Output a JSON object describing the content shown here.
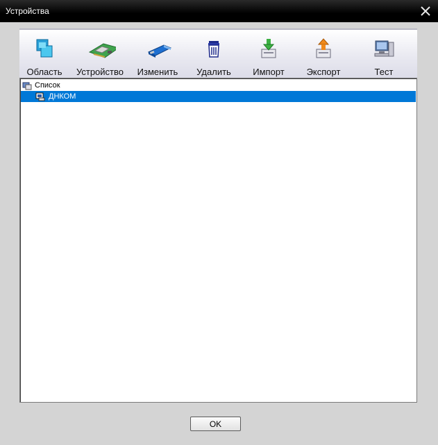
{
  "window": {
    "title": "Устройства"
  },
  "toolbar": {
    "items": [
      {
        "label": "Область",
        "icon": "area-icon"
      },
      {
        "label": "Устройство",
        "icon": "device-board-icon"
      },
      {
        "label": "Изменить",
        "icon": "edit-stick-icon"
      },
      {
        "label": "Удалить",
        "icon": "trash-icon"
      },
      {
        "label": "Импорт",
        "icon": "import-icon"
      },
      {
        "label": "Экспорт",
        "icon": "export-icon"
      },
      {
        "label": "Тест",
        "icon": "computer-test-icon"
      }
    ]
  },
  "tree": {
    "root": {
      "label": "Список",
      "icon": "list-root-icon"
    },
    "children": [
      {
        "label": "ДНКОМ",
        "icon": "area-node-icon",
        "selected": true
      }
    ]
  },
  "footer": {
    "ok_label": "OK"
  },
  "colors": {
    "selection": "#0078d7",
    "titlebar": "#000000",
    "dialog_bg": "#d4d4d4"
  }
}
